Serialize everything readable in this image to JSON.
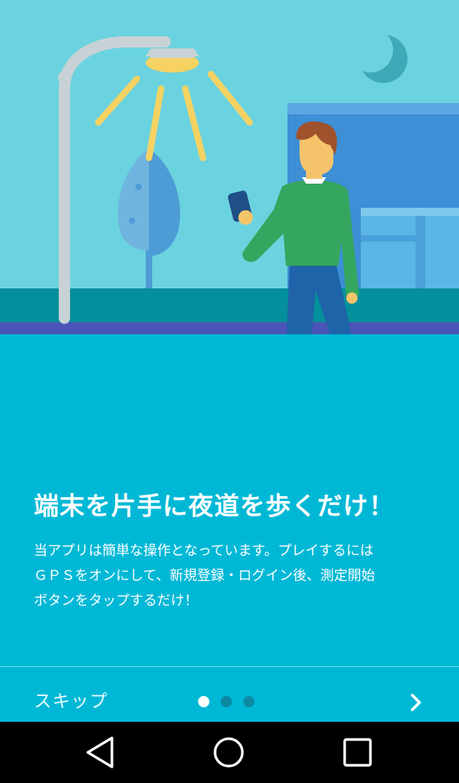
{
  "onboarding": {
    "title": "端末を片手に夜道を歩くだけ！",
    "body_lines": [
      "当アプリは簡単な操作となっています。プレイするには",
      "ＧＰＳをオンにして、新規登録・ログイン後、測定開始",
      "ボタンをタップするだけ！"
    ],
    "skip_label": "スキップ",
    "page_indicator": {
      "total": 3,
      "current": 1
    },
    "next_icon": "chevron-right-icon"
  },
  "nav_bar": {
    "back_icon": "back-triangle-icon",
    "home_icon": "home-circle-icon",
    "recents_icon": "recents-square-icon"
  },
  "colors": {
    "sky": "#6bd3df",
    "ground": "#00b8d6",
    "horizon_band": "#048f9d",
    "stripe": "#4a55b8",
    "sweater": "#34a65f",
    "pants": "#1f63a8",
    "lamp_light": "#f6d262"
  }
}
